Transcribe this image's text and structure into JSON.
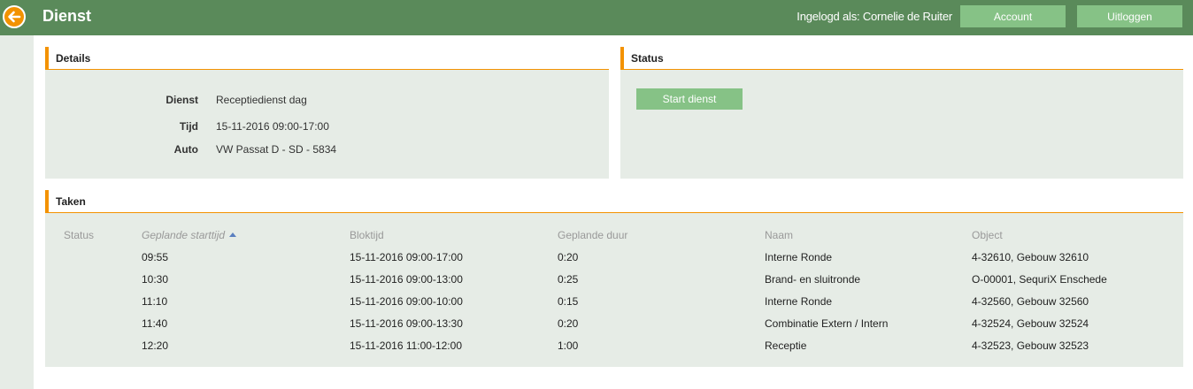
{
  "header": {
    "title": "Dienst",
    "login_label": "Ingelogd als: Cornelie de Ruiter",
    "account_label": "Account",
    "logout_label": "Uitloggen",
    "brand_color": "#5a8a5a",
    "accent_color": "#f39200",
    "back_icon": "arrow-left-icon"
  },
  "details": {
    "title": "Details",
    "rows": [
      {
        "label": "Dienst",
        "value": "Receptiedienst dag"
      },
      {
        "label": "Tijd",
        "value": "15-11-2016 09:00-17:00"
      },
      {
        "label": "Auto",
        "value": "VW Passat D - SD - 5834"
      }
    ]
  },
  "status": {
    "title": "Status",
    "start_label": "Start dienst"
  },
  "taken": {
    "title": "Taken",
    "columns": [
      "Status",
      "Geplande starttijd",
      "Bloktijd",
      "Geplande duur",
      "Naam",
      "Object"
    ],
    "sorted_column": "Geplande starttijd",
    "sort_direction": "ascending",
    "rows": [
      {
        "status": "",
        "starttijd": "09:55",
        "bloktijd": "15-11-2016 09:00-17:00",
        "duur": "0:20",
        "naam": "Interne Ronde",
        "object": "4-32610, Gebouw 32610"
      },
      {
        "status": "",
        "starttijd": "10:30",
        "bloktijd": "15-11-2016 09:00-13:00",
        "duur": "0:25",
        "naam": "Brand- en sluitronde",
        "object": "O-00001, SequriX Enschede"
      },
      {
        "status": "",
        "starttijd": "11:10",
        "bloktijd": "15-11-2016 09:00-10:00",
        "duur": "0:15",
        "naam": "Interne Ronde",
        "object": "4-32560, Gebouw 32560"
      },
      {
        "status": "",
        "starttijd": "11:40",
        "bloktijd": "15-11-2016 09:00-13:30",
        "duur": "0:20",
        "naam": "Combinatie Extern / Intern",
        "object": "4-32524, Gebouw 32524"
      },
      {
        "status": "",
        "starttijd": "12:20",
        "bloktijd": "15-11-2016 11:00-12:00",
        "duur": "1:00",
        "naam": "Receptie",
        "object": "4-32523, Gebouw 32523"
      }
    ]
  }
}
